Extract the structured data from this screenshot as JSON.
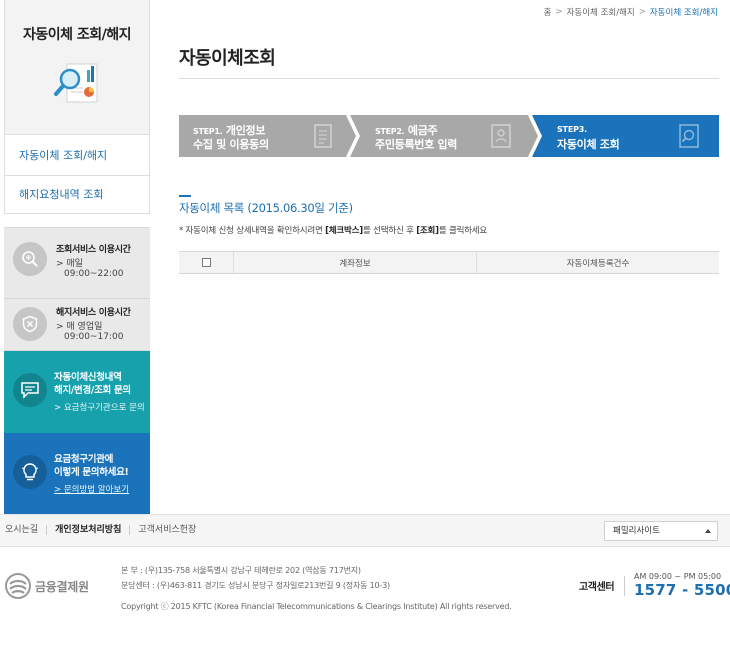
{
  "sidebar": {
    "title": "자동이체 조회/해지",
    "menu": [
      {
        "label": "자동이체 조회/해지"
      },
      {
        "label": "해지요청내역 조회"
      }
    ],
    "service_hours": {
      "inquiry_title": "조회서비스 이용시간",
      "inquiry_line1": "> 매일",
      "inquiry_line2": "09:00~22:00",
      "cancel_title": "해지서비스 이용시간",
      "cancel_line1": "> 매 영업일",
      "cancel_line2": "09:00~17:00"
    },
    "promo1": {
      "line1": "자동이체신청내역",
      "line2": "해지/변경/조회 문의",
      "link": "> 요금청구기관으로 문의"
    },
    "promo2": {
      "line1": "요금청구기관에",
      "line2": "이렇게 문의하세요!",
      "link": "> 문의방법 알아보기"
    }
  },
  "breadcrumb": {
    "home": "홈",
    "item1": "자동이체 조회/해지",
    "current": "자동이체 조회/해지",
    "sep": ">"
  },
  "page": {
    "title": "자동이체조회"
  },
  "steps": [
    {
      "label": "STEP1.",
      "line1": "개인정보",
      "line2": "수집 및 이용동의",
      "active": false
    },
    {
      "label": "STEP2.",
      "line1": "예금주",
      "line2": "주민등록번호 입력",
      "active": false
    },
    {
      "label": "STEP3.",
      "line1": "",
      "line2": "자동이체 조회",
      "active": true
    }
  ],
  "section": {
    "title": "자동이체 목록 (2015.06.30일 기준)",
    "notice_pre": "* 자동이체 신청 상세내역을 확인하시려면 ",
    "notice_b1": "[체크박스]",
    "notice_mid": "를 선택하신 후 ",
    "notice_b2": "[조회]",
    "notice_post": "를 클릭하세요"
  },
  "table": {
    "col_account": "계좌정보",
    "col_count": "자동이체등록건수"
  },
  "footer": {
    "links": [
      "오시는길",
      "개인정보처리방침",
      "고객서비스헌장"
    ],
    "family_site": "패밀리사이트",
    "logo_text": "금융결제원",
    "addr1": "본      부 : (우)135-758 서울특별시 강남구 테헤란로 202 (역삼동 717번지)",
    "addr2": "분당센터 : (우)463-811 경기도 성남시 분당구 정자일로213번길 9 (정자동 10-3)",
    "copyright": "Copyright ⓒ 2015 KFTC (Korea Financial Telecommunications & Clearings Institute) All rights reserved.",
    "cs_label": "고객센터",
    "cs_hours": "AM 09:00 ~ PM 05:00",
    "cs_phone": "1577 - 5500"
  },
  "colors": {
    "step_gray": "#a8a8a8",
    "step_active": "#1b74bb",
    "teal": "#17a1ad",
    "blue": "#1b74bb",
    "link_blue": "#1d6fb0"
  }
}
